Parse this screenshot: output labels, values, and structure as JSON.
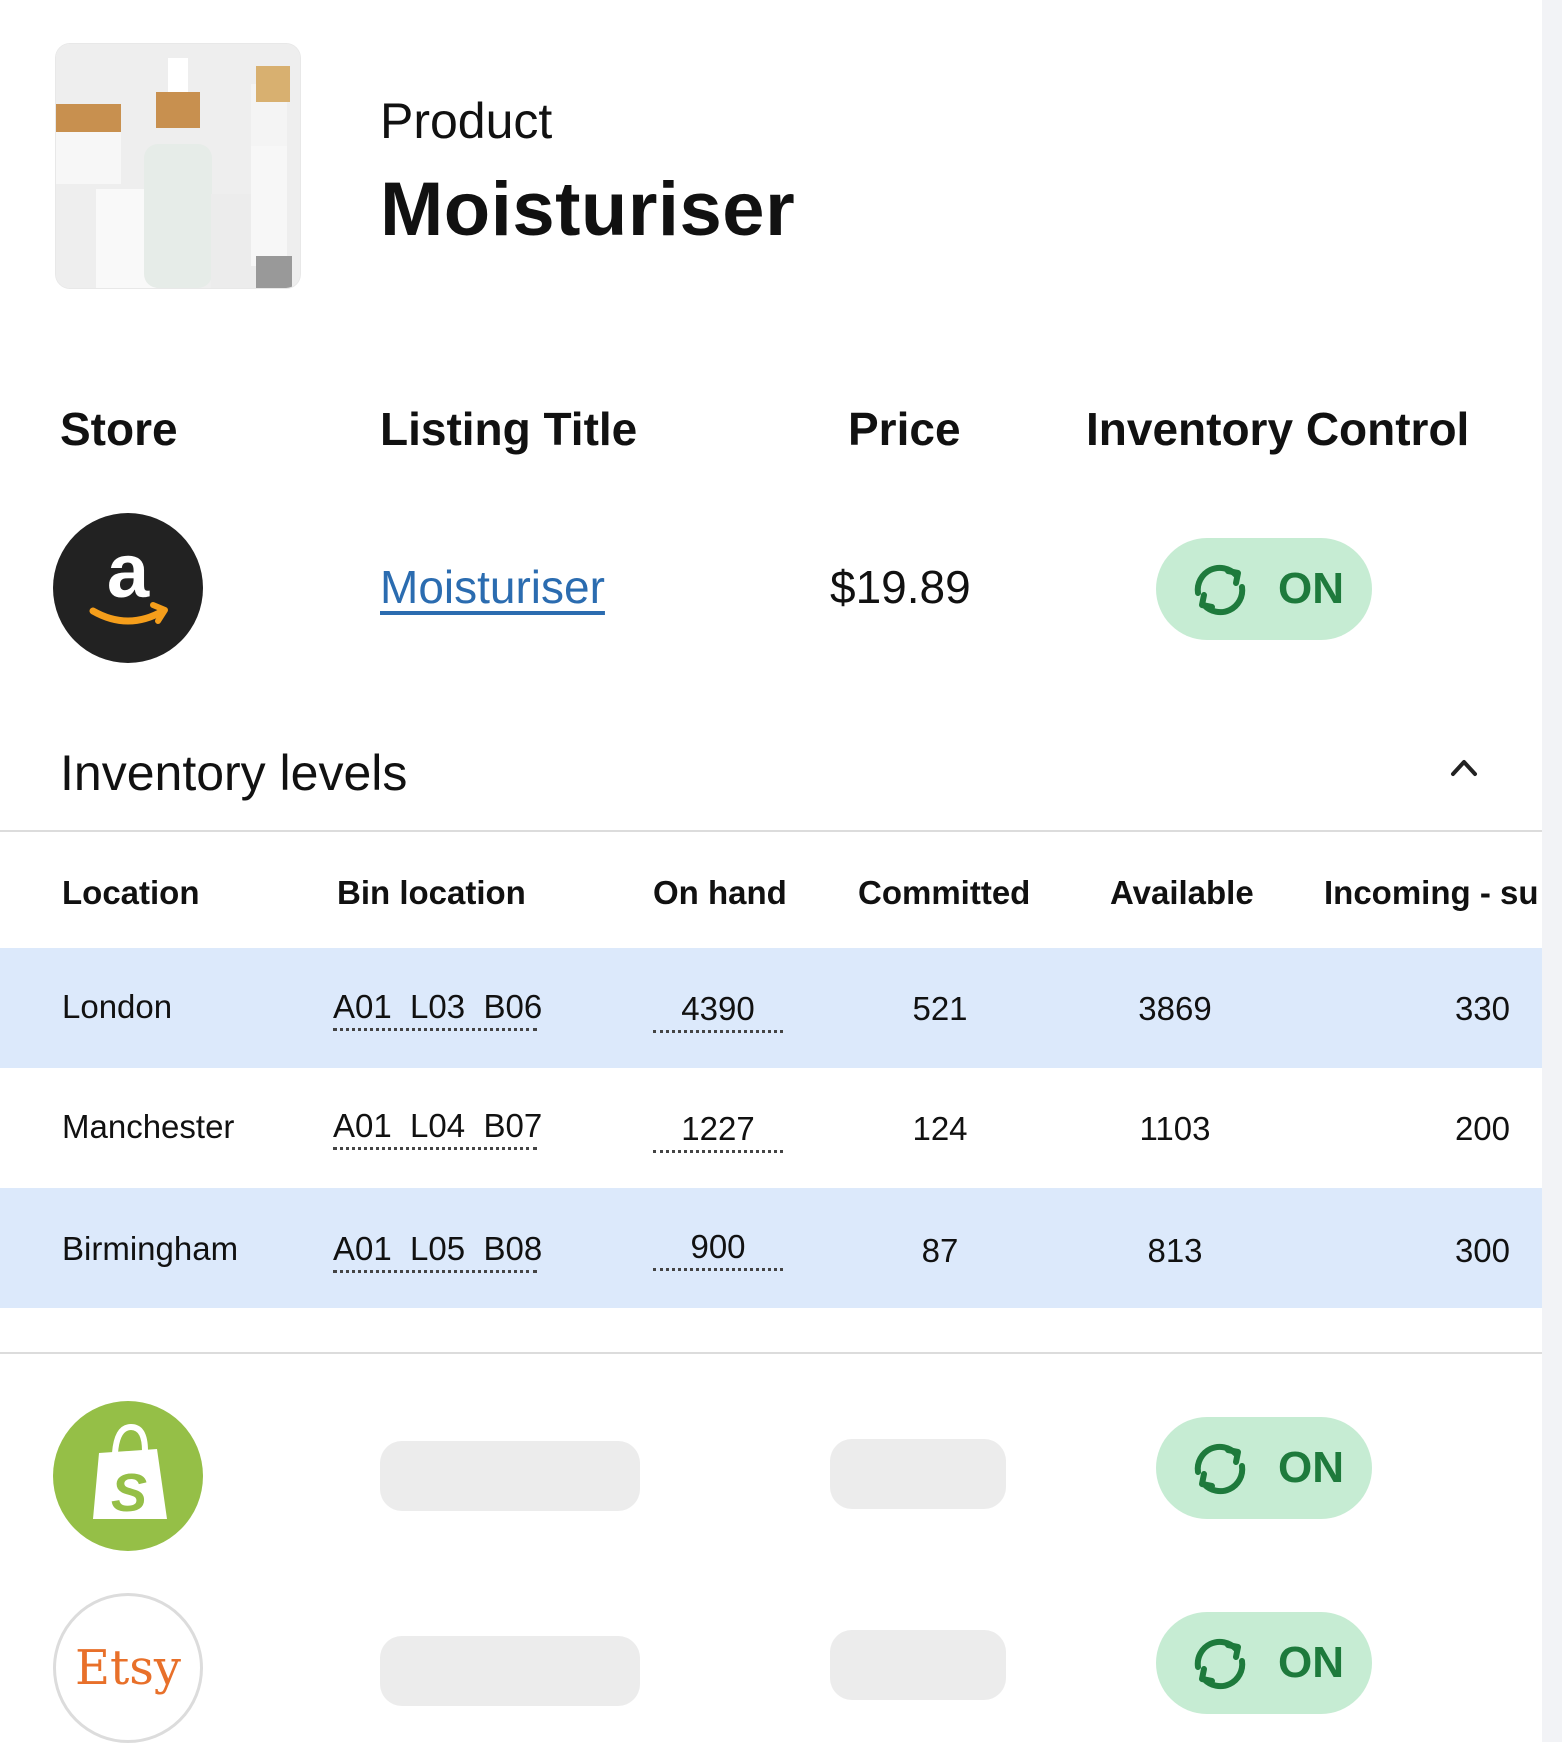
{
  "product": {
    "label": "Product",
    "name": "Moisturiser"
  },
  "listings_header": {
    "store": "Store",
    "listing_title": "Listing Title",
    "price": "Price",
    "inventory_control": "Inventory Control"
  },
  "listings": [
    {
      "store": "amazon",
      "store_icon": "amazon-logo-icon",
      "title": "Moisturiser",
      "price": "$19.89",
      "control": "ON"
    },
    {
      "store": "shopify",
      "store_icon": "shopify-logo-icon",
      "control": "ON"
    },
    {
      "store": "etsy",
      "store_icon": "etsy-logo-icon",
      "logo_text": "Etsy",
      "control": "ON"
    }
  ],
  "inventory": {
    "title": "Inventory levels",
    "columns": [
      "Location",
      "Bin location",
      "On hand",
      "Committed",
      "Available",
      "Incoming - su"
    ],
    "rows": [
      {
        "location": "London",
        "bin": "A01  L03  B06",
        "on_hand": "4390",
        "committed": "521",
        "available": "3869",
        "incoming": "330"
      },
      {
        "location": "Manchester",
        "bin": "A01  L04  B07",
        "on_hand": "1227",
        "committed": "124",
        "available": "1103",
        "incoming": "200"
      },
      {
        "location": "Birmingham",
        "bin": "A01  L05  B08",
        "on_hand": "900",
        "committed": "87",
        "available": "813",
        "incoming": "300"
      }
    ]
  },
  "colors": {
    "toggle_bg": "#c6ecd3",
    "toggle_text": "#1e7a3c",
    "link": "#2b6cb0",
    "row_highlight": "#dce9fb",
    "shopify": "#95bf47",
    "etsy": "#e8702a",
    "amazon_bg": "#222222"
  }
}
